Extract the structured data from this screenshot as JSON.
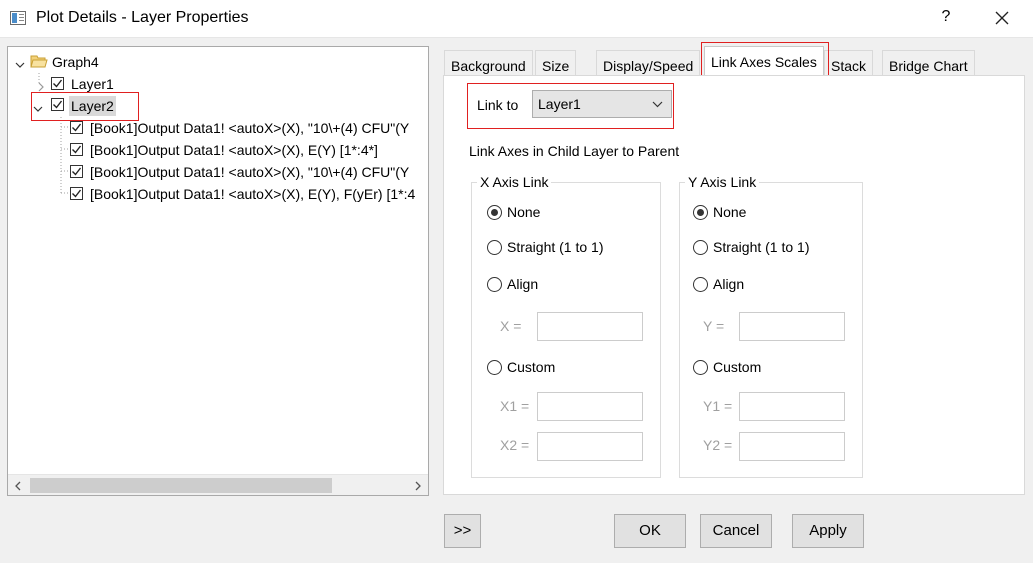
{
  "window": {
    "title": "Plot Details - Layer Properties",
    "help": "?"
  },
  "tree": {
    "root": "Graph4",
    "layer1": "Layer1",
    "layer2": "Layer2",
    "plots": [
      "[Book1]Output Data1! <autoX>(X), \"10\\+(4) CFU\"(Y",
      "[Book1]Output Data1! <autoX>(X), E(Y) [1*:4*]",
      "[Book1]Output Data1! <autoX>(X), \"10\\+(4) CFU\"(Y",
      "[Book1]Output Data1! <autoX>(X), E(Y), F(yEr) [1*:4"
    ]
  },
  "tabs": [
    "Background",
    "Size",
    "Display/Speed",
    "Link Axes Scales",
    "Stack",
    "Bridge Chart"
  ],
  "active_tab": "Link Axes Scales",
  "link": {
    "label": "Link to",
    "value": "Layer1",
    "heading": "Link Axes in Child Layer to Parent"
  },
  "x_group": {
    "title": "X Axis Link",
    "options": [
      "None",
      "Straight (1 to 1)",
      "Align",
      "Custom"
    ],
    "selected": "None",
    "align_label": "X =",
    "custom_labels": [
      "X1 =",
      "X2 ="
    ]
  },
  "y_group": {
    "title": "Y Axis Link",
    "options": [
      "None",
      "Straight (1 to 1)",
      "Align",
      "Custom"
    ],
    "selected": "None",
    "align_label": "Y =",
    "custom_labels": [
      "Y1 =",
      "Y2 ="
    ]
  },
  "buttons": {
    "expand": ">>",
    "ok": "OK",
    "cancel": "Cancel",
    "apply": "Apply"
  }
}
